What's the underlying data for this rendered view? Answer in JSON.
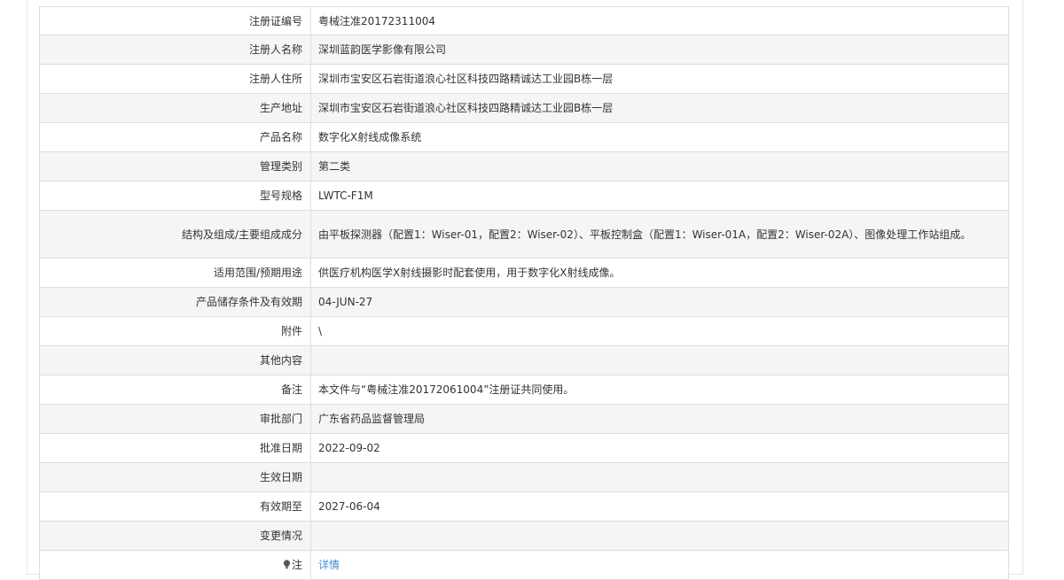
{
  "rows": [
    {
      "label": "注册证编号",
      "value": "粤械注准20172311004"
    },
    {
      "label": "注册人名称",
      "value": "深圳蓝韵医学影像有限公司"
    },
    {
      "label": "注册人住所",
      "value": "深圳市宝安区石岩街道浪心社区科技四路精诚达工业园B栋一层"
    },
    {
      "label": "生产地址",
      "value": "深圳市宝安区石岩街道浪心社区科技四路精诚达工业园B栋一层"
    },
    {
      "label": "产品名称",
      "value": "数字化X射线成像系统"
    },
    {
      "label": "管理类别",
      "value": "第二类"
    },
    {
      "label": "型号规格",
      "value": "LWTC-F1M"
    },
    {
      "label": "结构及组成/主要组成成分",
      "value": "由平板探测器（配置1：Wiser-01，配置2：Wiser-02）、平板控制盒（配置1：Wiser-01A，配置2：Wiser-02A）、图像处理工作站组成。"
    },
    {
      "label": "适用范围/预期用途",
      "value": "供医疗机构医学X射线摄影时配套使用，用于数字化X射线成像。"
    },
    {
      "label": "产品储存条件及有效期",
      "value": "04-JUN-27"
    },
    {
      "label": "附件",
      "value": "\\"
    },
    {
      "label": "其他内容",
      "value": ""
    },
    {
      "label": "备注",
      "value": "本文件与“粤械注准20172061004”注册证共同使用。"
    },
    {
      "label": "审批部门",
      "value": "广东省药品监督管理局"
    },
    {
      "label": "批准日期",
      "value": "2022-09-02"
    },
    {
      "label": "生效日期",
      "value": ""
    },
    {
      "label": "有效期至",
      "value": "2027-06-04"
    },
    {
      "label": "变更情况",
      "value": ""
    },
    {
      "label": "注",
      "value": "详情",
      "icon": "lightbulb-icon"
    }
  ],
  "colors": {
    "row_alt_bg": "#f5f5f5",
    "border": "#dddddd",
    "link": "#3b8fd6",
    "text": "#333333"
  }
}
